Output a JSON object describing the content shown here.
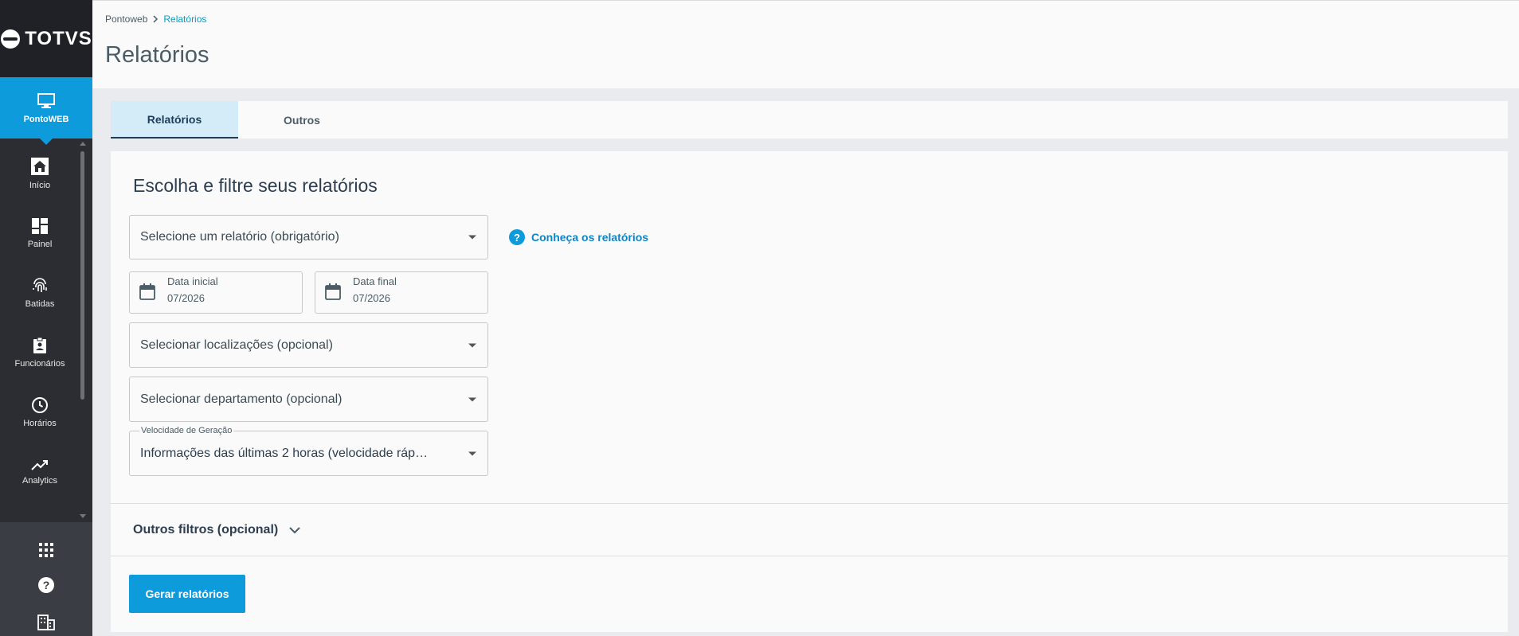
{
  "brand": {
    "logo_text": "TOTVS"
  },
  "sidebar": {
    "active": {
      "label": "PontoWEB",
      "icon": "monitor-icon"
    },
    "items": [
      {
        "label": "Início",
        "icon": "home-icon"
      },
      {
        "label": "Painel",
        "icon": "dashboard-icon"
      },
      {
        "label": "Batidas",
        "icon": "fingerprint-icon"
      },
      {
        "label": "Funcionários",
        "icon": "badge-icon"
      },
      {
        "label": "Horários",
        "icon": "clock-icon"
      },
      {
        "label": "Analytics",
        "icon": "trending-up-icon"
      }
    ],
    "bottom": [
      "apps-grid-icon",
      "help-icon",
      "building-icon"
    ]
  },
  "breadcrumb": {
    "root": "Pontoweb",
    "current": "Relatórios"
  },
  "page": {
    "title": "Relatórios"
  },
  "tabs": [
    {
      "label": "Relatórios",
      "active": true
    },
    {
      "label": "Outros",
      "active": false
    }
  ],
  "form": {
    "title": "Escolha e filtre seus relatórios",
    "report_select": "Selecione um relatório (obrigatório)",
    "help_link": "Conheça os relatórios",
    "start_date": {
      "label": "Data inicial",
      "value": "07/2026"
    },
    "end_date": {
      "label": "Data final",
      "value": "07/2026"
    },
    "location_select": "Selecionar localizações (opcional)",
    "department_select": "Selecionar departamento (opcional)",
    "speed": {
      "label": "Velocidade de Geração",
      "value": "Informações das últimas 2 horas (velocidade ráp…"
    },
    "other_filters": "Outros filtros (opcional)",
    "submit": "Gerar relatórios"
  },
  "colors": {
    "primary": "#0e9bdc",
    "sidebar": "#2b2d33",
    "link": "#0c86c7"
  }
}
